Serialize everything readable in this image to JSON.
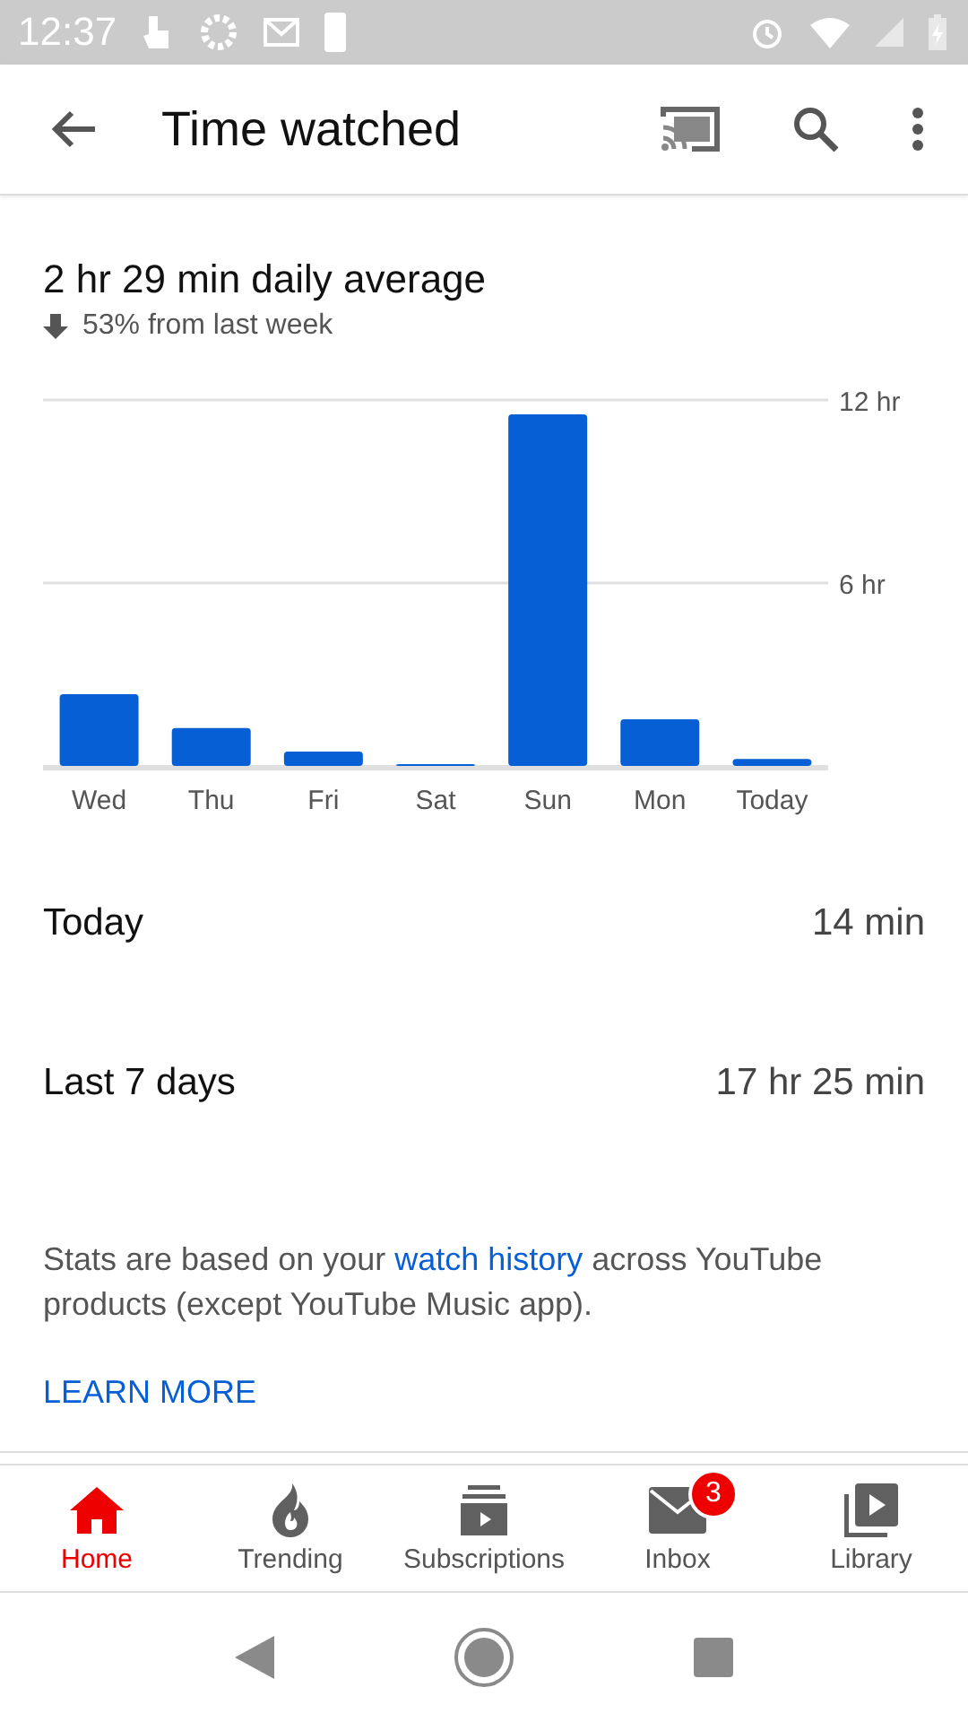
{
  "status_bar": {
    "time": "12:37"
  },
  "app_bar": {
    "title": "Time watched"
  },
  "summary": {
    "average": "2 hr 29 min daily average",
    "change": {
      "kind": "decrease",
      "text": "53% from last week"
    }
  },
  "chart_data": {
    "type": "bar",
    "categories": [
      "Wed",
      "Thu",
      "Fri",
      "Sat",
      "Sun",
      "Mon",
      "Today"
    ],
    "series": [
      {
        "color": "#065fd4",
        "values": [
          2.35,
          1.24,
          0.47,
          0.03,
          11.53,
          1.53,
          0.23
        ]
      }
    ],
    "ylim": [
      0,
      12
    ],
    "yticks": [
      {
        "value": 6,
        "label": "6 hr"
      },
      {
        "value": 12,
        "label": "12 hr"
      }
    ]
  },
  "stats": [
    {
      "label": "Today",
      "value": "14 min"
    },
    {
      "label": "Last 7 days",
      "value": "17 hr 25 min"
    }
  ],
  "footnote": {
    "before": "Stats are based on your ",
    "link": "watch history",
    "after": " across YouTube products (except YouTube Music app)."
  },
  "learn_more": "LEARN MORE",
  "bottom_nav": [
    {
      "kind": "home",
      "label": "Home",
      "selected": true
    },
    {
      "kind": "trending",
      "label": "Trending",
      "selected": false
    },
    {
      "kind": "subscriptions",
      "label": "Subscriptions",
      "selected": false
    },
    {
      "kind": "inbox",
      "label": "Inbox",
      "selected": false,
      "badge": "3"
    },
    {
      "kind": "library",
      "label": "Library",
      "selected": false
    }
  ]
}
